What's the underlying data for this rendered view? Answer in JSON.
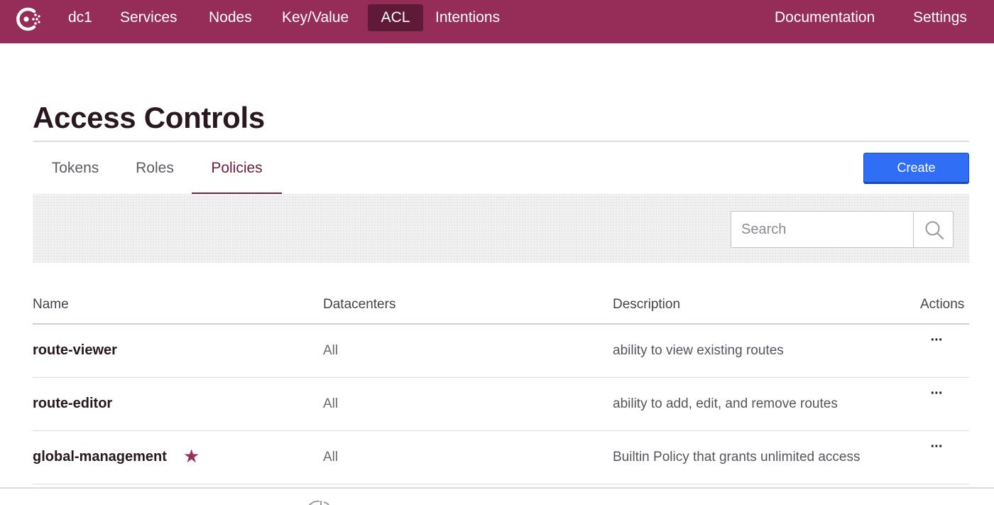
{
  "nav": {
    "items": [
      "dc1",
      "Services",
      "Nodes",
      "Key/Value",
      "ACL",
      "Intentions"
    ],
    "right_items": [
      "Documentation",
      "Settings"
    ],
    "active": "ACL",
    "brand_color": "#962d59"
  },
  "page": {
    "title": "Access Controls"
  },
  "tabs": {
    "items": [
      "Tokens",
      "Roles",
      "Policies"
    ],
    "active": "Policies"
  },
  "toolbar": {
    "create_label": "Create"
  },
  "search": {
    "placeholder": "Search",
    "value": ""
  },
  "table": {
    "headers": [
      "Name",
      "Datacenters",
      "Description",
      "Actions"
    ],
    "rows": [
      {
        "name": "route-viewer",
        "datacenters": "All",
        "description": "ability to view existing routes",
        "actions": "···",
        "builtin": false
      },
      {
        "name": "route-editor",
        "datacenters": "All",
        "description": "ability to add, edit, and remove routes",
        "actions": "···",
        "builtin": false
      },
      {
        "name": "global-management",
        "datacenters": "All",
        "description": "Builtin Policy that grants unlimited access",
        "actions": "···",
        "builtin": true
      }
    ]
  },
  "icons": {
    "logo": "consul-logo-icon",
    "search": "search-icon",
    "builtin": "star-icon",
    "actions": "ellipsis-icon"
  },
  "colors": {
    "accent_button": "#2f6ef5",
    "active_tab": "#7a2447",
    "star": "#9b2f5c"
  }
}
